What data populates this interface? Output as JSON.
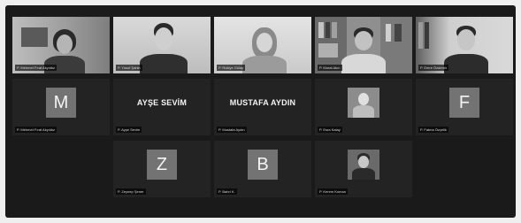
{
  "participants": [
    {
      "label": "P. Mehmet Fırat Akyıldız",
      "kind": "video",
      "active": true
    },
    {
      "label": "P. Yusuf Şahin",
      "kind": "video"
    },
    {
      "label": "P. Rukiye Gülay",
      "kind": "video"
    },
    {
      "label": "P. Murat Akın",
      "kind": "video"
    },
    {
      "label": "P. Emre Özdemir",
      "kind": "video"
    },
    {
      "label": "P. Mehmet Fırat Akyıldız",
      "kind": "avatar",
      "initial": "M"
    },
    {
      "label": "P. Ayşe Sevim",
      "kind": "name",
      "display": "AYŞE SEVİM"
    },
    {
      "label": "P. Mustafa Aydın",
      "kind": "name",
      "display": "MUSTAFA AYDIN"
    },
    {
      "label": "P. Esra Kalay",
      "kind": "thumb"
    },
    {
      "label": "P. Fatma Özçelik",
      "kind": "avatar",
      "initial": "F"
    },
    {
      "label": "P. Zeynep Şener",
      "kind": "avatar",
      "initial": "Z"
    },
    {
      "label": "P. Bahri K.",
      "kind": "avatar",
      "initial": "B"
    },
    {
      "label": "P. Kerem Koman",
      "kind": "thumb"
    }
  ]
}
